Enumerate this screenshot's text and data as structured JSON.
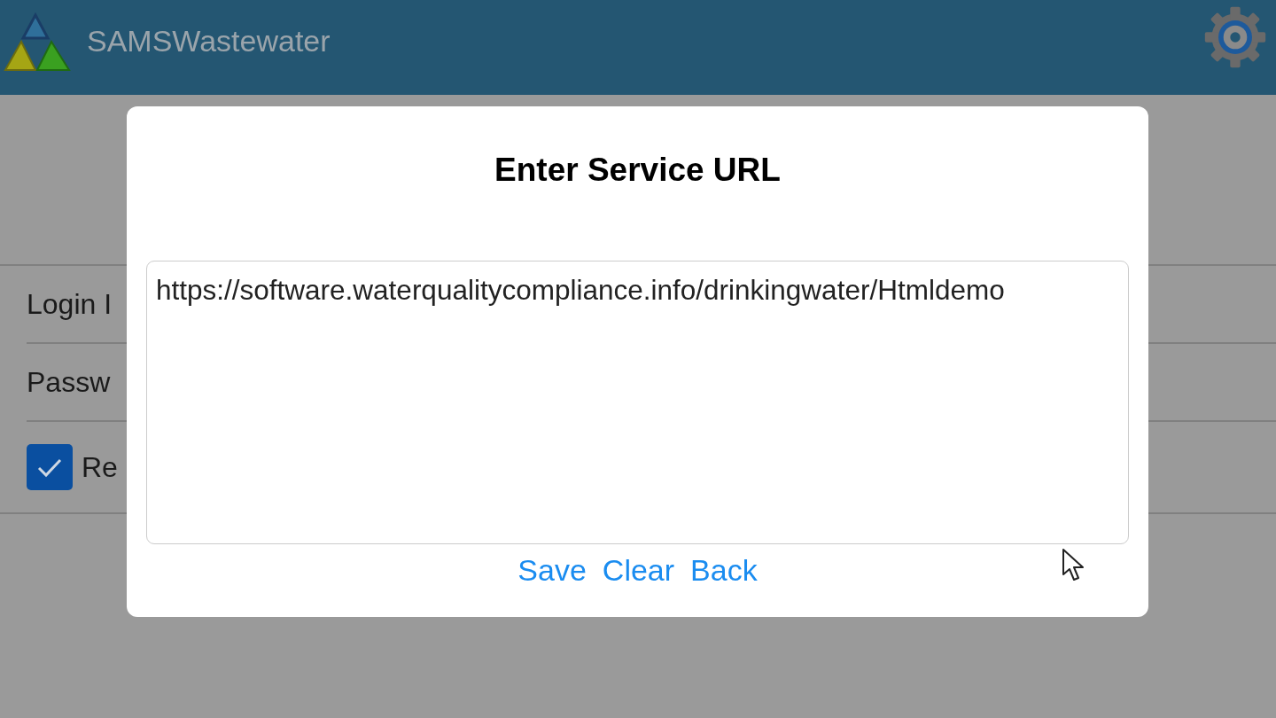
{
  "app": {
    "title": "SAMSWastewater"
  },
  "login_form": {
    "fields": [
      {
        "label": "Login I"
      },
      {
        "label": "Passw"
      }
    ],
    "remember": {
      "label": "Re",
      "checked": true
    }
  },
  "dialog": {
    "title": "Enter Service URL",
    "url_field": {
      "value": "https://software.waterqualitycompliance.info/drinkingwater/Htmldemo"
    },
    "buttons": [
      "Save",
      "Clear",
      "Back"
    ]
  }
}
